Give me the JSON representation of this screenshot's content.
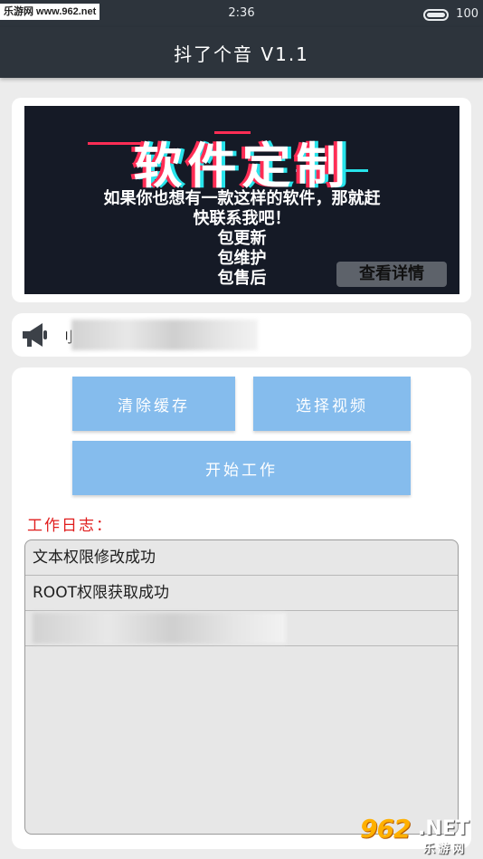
{
  "status_bar": {
    "watermark": "乐游网 www.962.net",
    "time": "2:36",
    "battery": "100"
  },
  "app": {
    "title": "抖了个音 V1.1"
  },
  "banner": {
    "headline": "软件定制",
    "lines": [
      "如果你也想有一款这样的软件，那就赶",
      "快联系我吧！",
      "包更新",
      "包维护",
      "包售后"
    ],
    "button_label": "查看详情"
  },
  "notice": {
    "icon": "megaphone-icon",
    "text": "刂"
  },
  "actions": {
    "clear_cache": "清除缓存",
    "select_video": "选择视频",
    "start_work": "开始工作"
  },
  "log": {
    "label": "工作日志：",
    "entries": [
      "文本权限修改成功",
      "ROOT权限获取成功"
    ]
  },
  "corner_logo": {
    "brand": "962",
    "suffix": ".NET",
    "caption": "乐游网"
  },
  "colors": {
    "bar": "#2d343c",
    "button": "#85bced",
    "log_label": "#e01d1d"
  }
}
